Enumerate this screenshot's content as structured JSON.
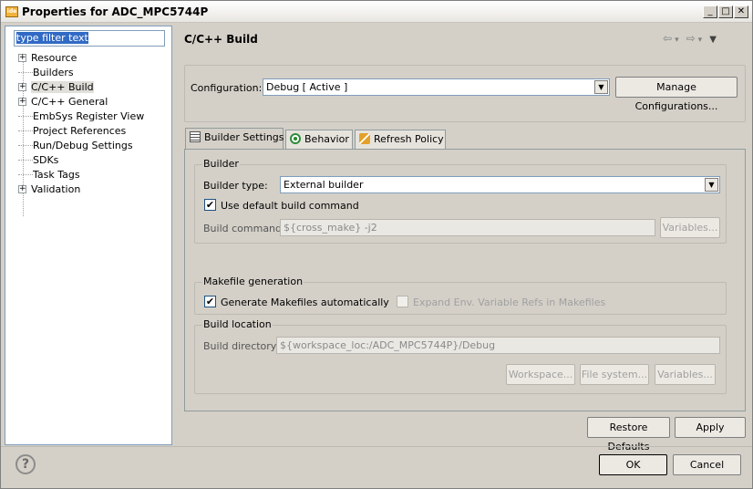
{
  "window": {
    "title": "Properties for ADC_MPC5744P",
    "app_icon": "eclipse-app-icon",
    "minimize": "_",
    "maximize": "□",
    "close": "✕"
  },
  "sidebar": {
    "filter_text": "type filter text",
    "items": [
      {
        "label": "Resource",
        "expandable": true
      },
      {
        "label": "Builders",
        "expandable": false
      },
      {
        "label": "C/C++ Build",
        "expandable": true,
        "selected": true
      },
      {
        "label": "C/C++ General",
        "expandable": true
      },
      {
        "label": "EmbSys Register View",
        "expandable": false
      },
      {
        "label": "Project References",
        "expandable": false
      },
      {
        "label": "Run/Debug Settings",
        "expandable": false
      },
      {
        "label": "SDKs",
        "expandable": false
      },
      {
        "label": "Task Tags",
        "expandable": false
      },
      {
        "label": "Validation",
        "expandable": true
      }
    ],
    "expand_glyph": "+"
  },
  "main": {
    "page_title": "C/C++ Build",
    "nav": {
      "back": "⇦",
      "back_menu": "▾",
      "forward": "⇨",
      "forward_menu": "▾",
      "view_menu": "▼"
    },
    "configuration_label": "Configuration:",
    "configuration_value": "Debug  [ Active ]",
    "manage_configurations": "Manage Configurations...",
    "tabs": [
      {
        "label": "Builder Settings",
        "icon": "builder-settings-icon",
        "active": true
      },
      {
        "label": "Behavior",
        "icon": "behavior-icon"
      },
      {
        "label": "Refresh Policy",
        "icon": "refresh-policy-icon"
      }
    ],
    "builder": {
      "group_label": "Builder",
      "builder_type_label": "Builder type:",
      "builder_type_value": "External builder",
      "use_default_label": "Use default build command",
      "use_default_checked": true,
      "build_command_label": "Build command:",
      "build_command_value": "${cross_make} -j2",
      "variables_label": "Variables..."
    },
    "makefile": {
      "group_label": "Makefile generation",
      "generate_label": "Generate Makefiles automatically",
      "generate_checked": true,
      "expand_label": "Expand Env. Variable Refs in Makefiles",
      "expand_checked": false
    },
    "location": {
      "group_label": "Build location",
      "build_dir_label": "Build directory:",
      "build_dir_value": "${workspace_loc:/ADC_MPC5744P}/Debug",
      "workspace_label": "Workspace...",
      "filesystem_label": "File system...",
      "variables_label": "Variables..."
    },
    "restore_defaults": "Restore Defaults",
    "apply": "Apply"
  },
  "footer": {
    "help": "?",
    "ok": "OK",
    "cancel": "Cancel"
  },
  "check_glyph": "✔",
  "dropdown_glyph": "▼"
}
